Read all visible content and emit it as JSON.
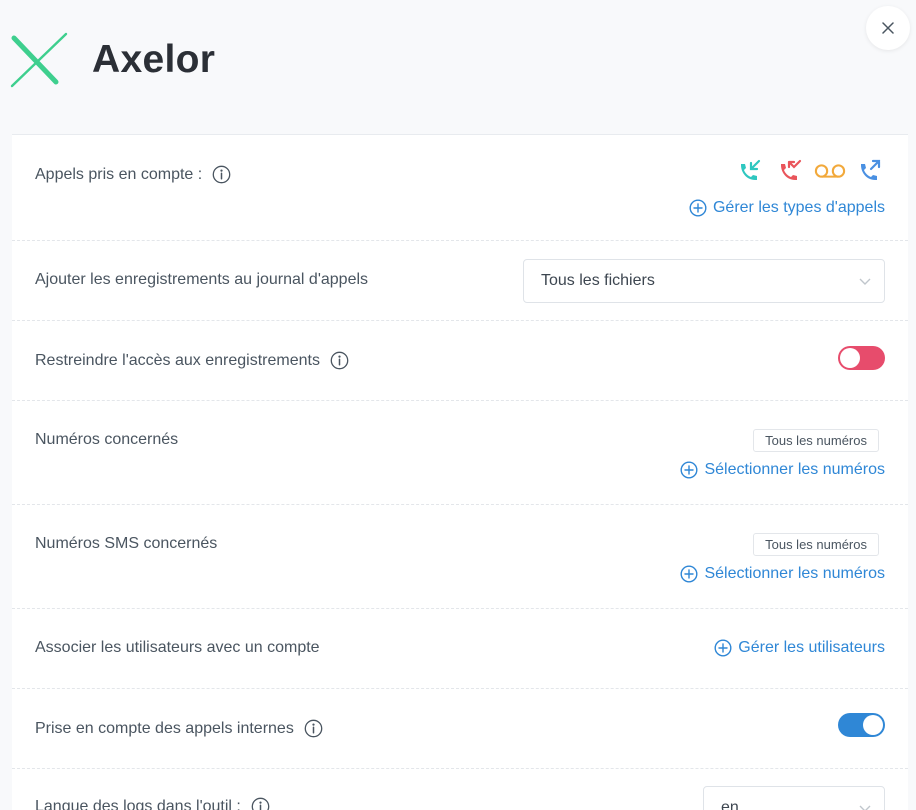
{
  "app": {
    "brand": "Axelor",
    "accent": "#2f87d6",
    "logo_color": "#3ecf8e"
  },
  "rows": {
    "calls": {
      "label": "Appels pris en compte :",
      "link": "Gérer les types d'appels",
      "icons": [
        "incoming-call-icon",
        "missed-call-icon",
        "voicemail-icon",
        "outgoing-call-icon"
      ]
    },
    "recordings": {
      "label": "Ajouter les enregistrements au journal d'appels",
      "value": "Tous les fichiers"
    },
    "restrict": {
      "label": "Restreindre l'accès aux enregistrements",
      "enabled": false
    },
    "numbers": {
      "label": "Numéros concernés",
      "chip": "Tous les numéros",
      "link": "Sélectionner les numéros"
    },
    "sms_numbers": {
      "label": "Numéros SMS concernés",
      "chip": "Tous les numéros",
      "link": "Sélectionner les numéros"
    },
    "users": {
      "label": "Associer les utilisateurs avec un compte",
      "link": "Gérer les utilisateurs"
    },
    "internal": {
      "label": "Prise en compte des appels internes",
      "enabled": true
    },
    "language": {
      "label": "Langue des logs dans l'outil :",
      "value": "en"
    }
  }
}
